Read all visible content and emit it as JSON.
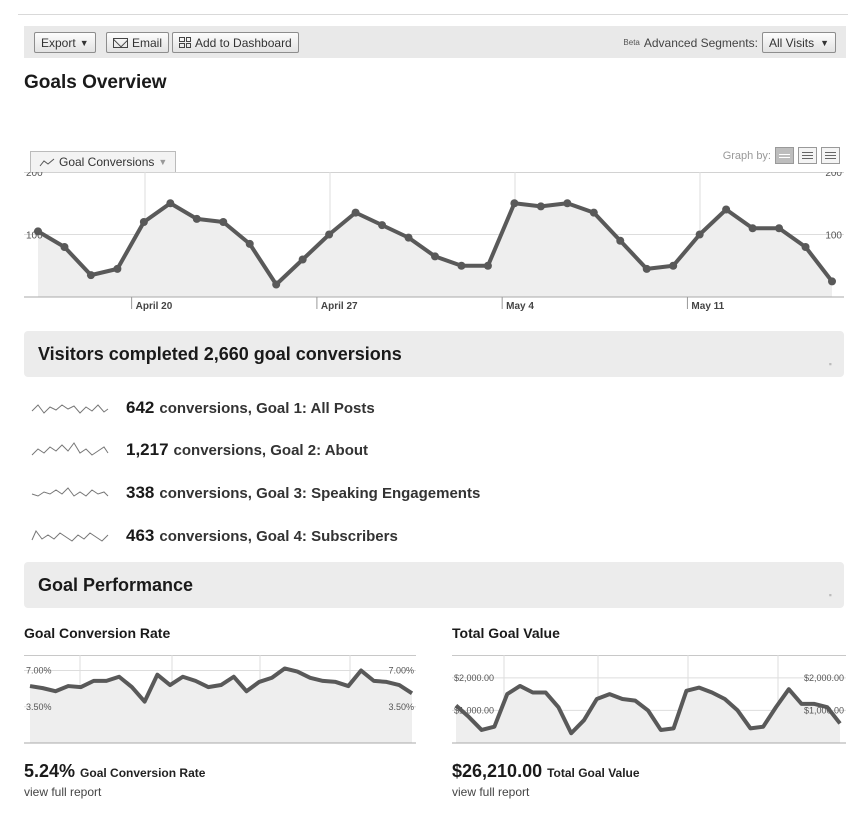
{
  "toolbar": {
    "export_label": "Export",
    "email_label": "Email",
    "add_dashboard_label": "Add to Dashboard",
    "beta_label": "Beta",
    "segments_label": "Advanced Segments:",
    "segment_value": "All Visits"
  },
  "page_title": "Goals Overview",
  "graph": {
    "metric_label": "Goal Conversions",
    "graph_by_label": "Graph by:"
  },
  "summary": {
    "title": "Visitors completed 2,660 goal conversions",
    "goals": [
      {
        "count": "642",
        "label": "conversions, Goal 1: All Posts"
      },
      {
        "count": "1,217",
        "label": "conversions, Goal 2: About"
      },
      {
        "count": "338",
        "label": "conversions, Goal 3: Speaking Engagements"
      },
      {
        "count": "463",
        "label": "conversions, Goal 4: Subscribers"
      }
    ]
  },
  "performance": {
    "title": "Goal Performance",
    "rate_title": "Goal Conversion Rate",
    "rate_value": "5.24%",
    "rate_label": "Goal Conversion Rate",
    "rate_link": "view full report",
    "value_title": "Total Goal Value",
    "value_value": "$26,210.00",
    "value_label": "Total Goal Value",
    "value_link": "view full report"
  },
  "colors": {
    "line": "#595959",
    "fill": "#eeeeee",
    "grid": "#dddddd",
    "bar": "#ececec"
  },
  "chart_data": [
    {
      "type": "area",
      "series": [
        {
          "name": "Goal Conversions",
          "values": [
            105,
            80,
            35,
            45,
            120,
            150,
            125,
            120,
            85,
            20,
            60,
            100,
            135,
            115,
            95,
            65,
            50,
            50,
            150,
            145,
            150,
            135,
            90,
            45,
            50,
            100,
            140,
            110,
            110,
            80,
            25
          ]
        }
      ],
      "ylim": [
        0,
        200
      ],
      "yticks": [
        "100",
        "200"
      ],
      "xticks": [
        {
          "label": "April 20",
          "index": 4
        },
        {
          "label": "April 27",
          "index": 11
        },
        {
          "label": "May 4",
          "index": 18
        },
        {
          "label": "May 11",
          "index": 25
        }
      ],
      "grid": true
    },
    {
      "type": "area",
      "title": "Goal Conversion Rate",
      "series": [
        {
          "name": "Goal Conversion Rate",
          "values": [
            5.5,
            5.3,
            5.0,
            5.5,
            5.4,
            6.0,
            6.0,
            6.4,
            5.4,
            4.0,
            6.6,
            5.6,
            6.4,
            6.0,
            5.4,
            5.6,
            6.4,
            5.0,
            5.9,
            6.3,
            7.2,
            6.9,
            6.3,
            6.0,
            5.9,
            5.5,
            7.0,
            6.0,
            5.9,
            5.6,
            4.8
          ]
        }
      ],
      "ylim": [
        0,
        8.5
      ],
      "yticks": [
        "3.50%",
        "7.00%"
      ],
      "grid": true
    },
    {
      "type": "area",
      "title": "Total Goal Value",
      "series": [
        {
          "name": "Total Goal Value",
          "values": [
            1150,
            800,
            400,
            500,
            1500,
            1750,
            1550,
            1550,
            1100,
            300,
            700,
            1350,
            1500,
            1350,
            1300,
            1000,
            400,
            450,
            1600,
            1700,
            1550,
            1350,
            1000,
            450,
            500,
            1100,
            1650,
            1200,
            1200,
            1100,
            600
          ]
        }
      ],
      "ylim": [
        0,
        2700
      ],
      "yticks": [
        "$1,000.00",
        "$2,000.00"
      ],
      "grid": true
    }
  ]
}
